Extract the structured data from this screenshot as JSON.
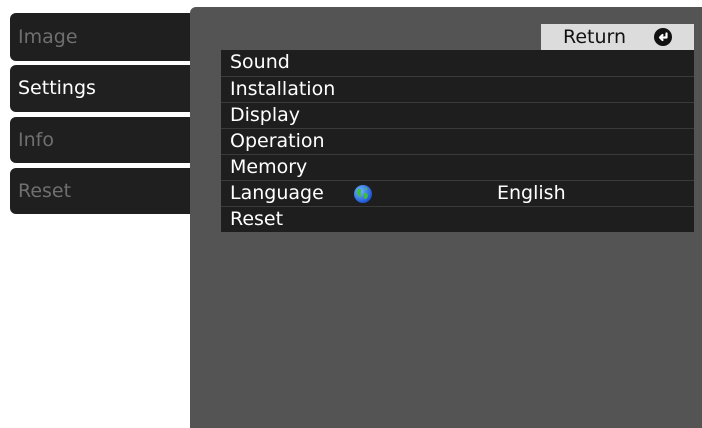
{
  "tabs": [
    {
      "label": "Image"
    },
    {
      "label": "Settings"
    },
    {
      "label": "Info"
    },
    {
      "label": "Reset"
    }
  ],
  "active_tab": "Settings",
  "return_button": {
    "label": "Return",
    "icon": "return-icon"
  },
  "menu": {
    "items": [
      {
        "label": "Sound"
      },
      {
        "label": "Installation"
      },
      {
        "label": "Display"
      },
      {
        "label": "Operation"
      },
      {
        "label": "Memory"
      },
      {
        "label": "Language",
        "icon": "globe-icon",
        "value": "English"
      },
      {
        "label": "Reset"
      }
    ]
  },
  "colors": {
    "panel_bg": "#545454",
    "row_bg": "#1e1e1e",
    "tab_bg": "#1f1f1f",
    "tab_inactive_text": "#6f6f6f",
    "return_bg": "#dcdcdc"
  }
}
